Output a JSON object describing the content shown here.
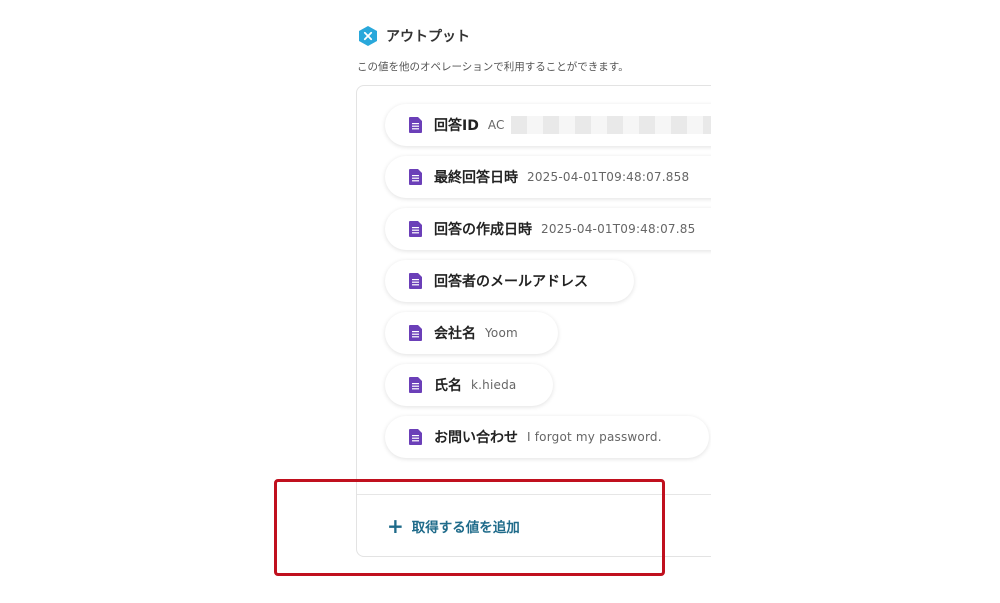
{
  "output": {
    "title": "アウトプット",
    "description": "この値を他のオペレーションで利用することができます。",
    "icon": "close-hex-icon",
    "icon_color": "#29a8db"
  },
  "items": [
    {
      "label": "回答ID",
      "value": "AC"
    },
    {
      "label": "最終回答日時",
      "value": "2025-04-01T09:48:07.858"
    },
    {
      "label": "回答の作成日時",
      "value": "2025-04-01T09:48:07.85"
    },
    {
      "label": "回答者のメールアドレス",
      "value": ""
    },
    {
      "label": "会社名",
      "value": "Yoom"
    },
    {
      "label": "氏名",
      "value": "k.hieda"
    },
    {
      "label": "お問い合わせ",
      "value": "I forgot my password."
    }
  ],
  "add_button": {
    "label": "取得する値を追加",
    "icon": "plus-icon",
    "color": "#1f6b8a"
  },
  "colors": {
    "doc_icon": "#6b3fb8",
    "highlight": "#c0101e"
  }
}
